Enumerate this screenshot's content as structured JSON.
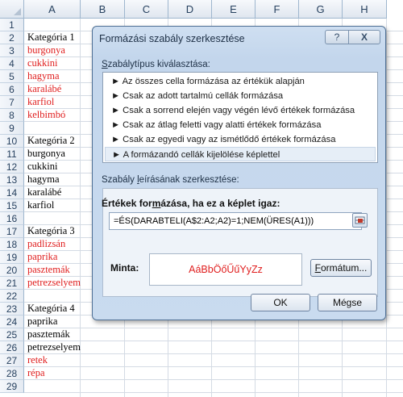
{
  "sheet": {
    "columns": [
      "A",
      "B",
      "C",
      "D",
      "E",
      "F",
      "G",
      "H"
    ],
    "rows": [
      {
        "n": "1",
        "text": "",
        "red": false
      },
      {
        "n": "2",
        "text": "Kategória 1",
        "red": false
      },
      {
        "n": "3",
        "text": "burgonya",
        "red": true
      },
      {
        "n": "4",
        "text": "cukkini",
        "red": true
      },
      {
        "n": "5",
        "text": "hagyma",
        "red": true
      },
      {
        "n": "6",
        "text": "karalábé",
        "red": true
      },
      {
        "n": "7",
        "text": "karfiol",
        "red": true
      },
      {
        "n": "8",
        "text": "kelbimbó",
        "red": true
      },
      {
        "n": "9",
        "text": "",
        "red": false
      },
      {
        "n": "10",
        "text": "Kategória 2",
        "red": false
      },
      {
        "n": "11",
        "text": "burgonya",
        "red": false
      },
      {
        "n": "12",
        "text": "cukkini",
        "red": false
      },
      {
        "n": "13",
        "text": "hagyma",
        "red": false
      },
      {
        "n": "14",
        "text": "karalábé",
        "red": false
      },
      {
        "n": "15",
        "text": "karfiol",
        "red": false
      },
      {
        "n": "16",
        "text": "",
        "red": false
      },
      {
        "n": "17",
        "text": "Kategória 3",
        "red": false
      },
      {
        "n": "18",
        "text": "padlizsán",
        "red": true
      },
      {
        "n": "19",
        "text": "paprika",
        "red": true
      },
      {
        "n": "20",
        "text": "pasztemák",
        "red": true
      },
      {
        "n": "21",
        "text": "petrezselyem",
        "red": true
      },
      {
        "n": "22",
        "text": "",
        "red": false
      },
      {
        "n": "23",
        "text": "Kategória 4",
        "red": false
      },
      {
        "n": "24",
        "text": "paprika",
        "red": false
      },
      {
        "n": "25",
        "text": "pasztemák",
        "red": false
      },
      {
        "n": "26",
        "text": "petrezselyem",
        "red": false
      },
      {
        "n": "27",
        "text": "retek",
        "red": true
      },
      {
        "n": "28",
        "text": "répa",
        "red": true
      },
      {
        "n": "29",
        "text": "",
        "red": false
      }
    ],
    "red_color": "#e02020"
  },
  "dialog": {
    "title": "Formázási szabály szerkesztése",
    "help_label": "?",
    "close_label": "X",
    "type_section_label": "Szabálytípus kiválasztása:",
    "rule_types": [
      "► Az összes cella formázása az értékük alapján",
      "► Csak az adott tartalmú cellák formázása",
      "► Csak a sorrend elején vagy végén lévő értékek formázása",
      "► Csak az átlag feletti vagy alatti értékek formázása",
      "► Csak az egyedi vagy az ismétlődő értékek formázása",
      "► A formázandó cellák kijelölése képlettel"
    ],
    "selected_index": 5,
    "desc_section_label": "Szabály leírásának szerkesztése:",
    "formula_label": "Értékek formázása, ha ez a képlet igaz:",
    "formula_value": "=ÉS(DARABTELI(A$2:A2;A2)=1;NEM(ÜRES(A1)))",
    "preview_label": "Minta:",
    "preview_text": "AáBbÖőŰűYyZz",
    "format_button": "Formátum...",
    "ok_button": "OK",
    "cancel_button": "Mégse",
    "accent_color": "#e01f1f"
  }
}
